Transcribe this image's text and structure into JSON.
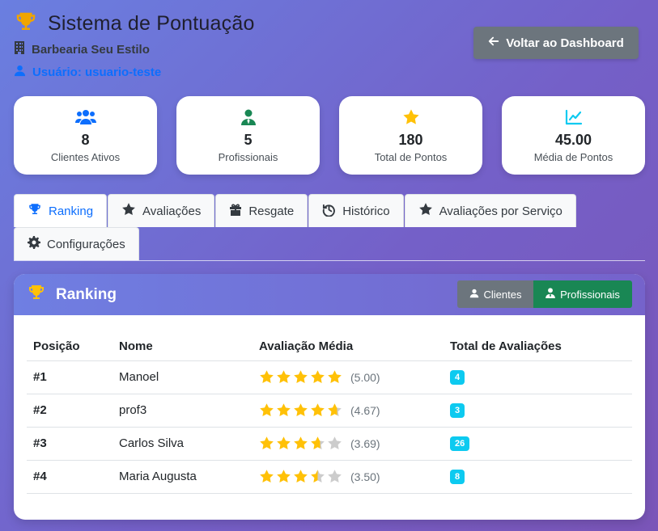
{
  "header": {
    "title": "Sistema de Pontuação",
    "business": "Barbearia Seu Estilo",
    "user": "Usuário: usuario-teste",
    "back_label": "Voltar ao Dashboard"
  },
  "stats": [
    {
      "icon": "users-icon",
      "value": "8",
      "label": "Clientes Ativos",
      "color": "#0d6efd"
    },
    {
      "icon": "professional-icon",
      "value": "5",
      "label": "Profissionais",
      "color": "#198754"
    },
    {
      "icon": "star-icon",
      "value": "180",
      "label": "Total de Pontos",
      "color": "#ffc107"
    },
    {
      "icon": "chart-line-icon",
      "value": "45.00",
      "label": "Média de Pontos",
      "color": "#0dcaf0"
    }
  ],
  "tabs": [
    {
      "label": "Ranking",
      "icon": "trophy-icon",
      "active": true
    },
    {
      "label": "Avaliações",
      "icon": "star-icon",
      "active": false
    },
    {
      "label": "Resgate",
      "icon": "gift-icon",
      "active": false
    },
    {
      "label": "Histórico",
      "icon": "history-icon",
      "active": false
    },
    {
      "label": "Avaliações por Serviço",
      "icon": "star-icon",
      "active": false
    },
    {
      "label": "Configurações",
      "icon": "gear-icon",
      "active": false
    }
  ],
  "panel": {
    "title": "Ranking",
    "toggle": {
      "clients_label": "Clientes",
      "professionals_label": "Profissionais",
      "selected": "Profissionais"
    },
    "columns": [
      "Posição",
      "Nome",
      "Avaliação Média",
      "Total de Avaliações"
    ],
    "rows": [
      {
        "position": "#1",
        "name": "Manoel",
        "rating": 5.0,
        "rating_text": "(5.00)",
        "total": "4"
      },
      {
        "position": "#2",
        "name": "prof3",
        "rating": 4.67,
        "rating_text": "(4.67)",
        "total": "3"
      },
      {
        "position": "#3",
        "name": "Carlos Silva",
        "rating": 3.69,
        "rating_text": "(3.69)",
        "total": "26"
      },
      {
        "position": "#4",
        "name": "Maria Augusta",
        "rating": 3.5,
        "rating_text": "(3.50)",
        "total": "8"
      }
    ]
  },
  "colors": {
    "accent": "#0d6efd",
    "star": "#ffc107",
    "star_empty": "#cccccc",
    "badge": "#0dcaf0",
    "success": "#198754",
    "secondary": "#6c757d"
  }
}
